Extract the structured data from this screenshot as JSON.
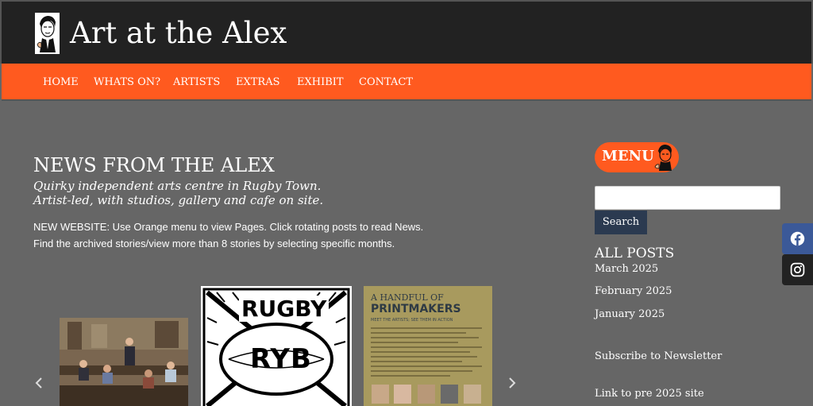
{
  "header": {
    "site_title": "Art at the Alex"
  },
  "nav": {
    "items": [
      {
        "label": "HOME"
      },
      {
        "label": "WHATS ON?"
      },
      {
        "label": "ARTISTS"
      },
      {
        "label": "EXTRAS"
      },
      {
        "label": "EXHIBIT"
      },
      {
        "label": "CONTACT"
      }
    ]
  },
  "main": {
    "title": "NEWS FROM THE ALEX",
    "tagline_1": "Quirky independent arts centre in Rugby Town.",
    "tagline_2": "Artist-led, with studios, gallery and cafe on site.",
    "notice_1": "NEW WEBSITE: Use Orange menu to view Pages. Click rotating posts to read News.",
    "notice_2": "Find the archived stories/view more than 8 stories by selecting specific months."
  },
  "carousel": {
    "prev_icon": "chevron-left-icon",
    "next_icon": "chevron-right-icon",
    "slide_2": {
      "line_1": "RUGBY",
      "line_2": "RYB"
    },
    "slide_3": {
      "line_1": "A HANDFUL OF",
      "line_2": "PRINTMAKERS",
      "line_3": "MEET THE ARTISTS; SEE THEM IN ACTION"
    }
  },
  "sidebar": {
    "menu_badge": "MENU",
    "search_placeholder": "",
    "search_button": "Search",
    "all_posts_heading": "ALL POSTS",
    "months": [
      "March 2025",
      "February 2025",
      "January 2025"
    ],
    "subscribe": "Subscribe to Newsletter",
    "old_site": "Link to pre 2025 site"
  },
  "social": {
    "facebook_icon": "facebook-icon",
    "instagram_icon": "instagram-icon"
  },
  "colors": {
    "accent": "#ff5a1f",
    "header_bg": "#222222",
    "page_bg": "#666666",
    "button_bg": "#2b3a50",
    "social_fb": "#3b5998",
    "social_ig": "#222222"
  }
}
